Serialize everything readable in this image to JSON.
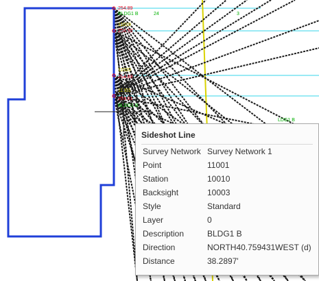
{
  "tooltip": {
    "title": "Sideshot Line",
    "rows": [
      {
        "key": "Survey Network",
        "value": "Survey Network 1"
      },
      {
        "key": "Point",
        "value": "11001"
      },
      {
        "key": "Station",
        "value": "10010"
      },
      {
        "key": "Backsight",
        "value": "10003"
      },
      {
        "key": "Style",
        "value": "Standard"
      },
      {
        "key": "Layer",
        "value": "0"
      },
      {
        "key": "Description",
        "value": "BLDG1 B"
      },
      {
        "key": "Direction",
        "value": "NORTH40.759431WEST (d)"
      },
      {
        "key": "Distance",
        "value": "38.2897'"
      }
    ]
  },
  "drawing": {
    "colors": {
      "building": "#1f3fd8",
      "sideshot": "#1a1a1a",
      "label_red": "#e0001a",
      "label_green": "#00b000",
      "label_yellow": "#c9c400",
      "cyan_line": "#36d6e8"
    },
    "labels_red": [
      "254.89",
      "254.90",
      "254.89",
      "254.01"
    ],
    "labels_green": [
      "BLDG1 B",
      "24",
      "3",
      "BLDG1 B",
      "LDG1 B"
    ],
    "labels_yellow": [
      "11019",
      "11020",
      "11001"
    ]
  }
}
